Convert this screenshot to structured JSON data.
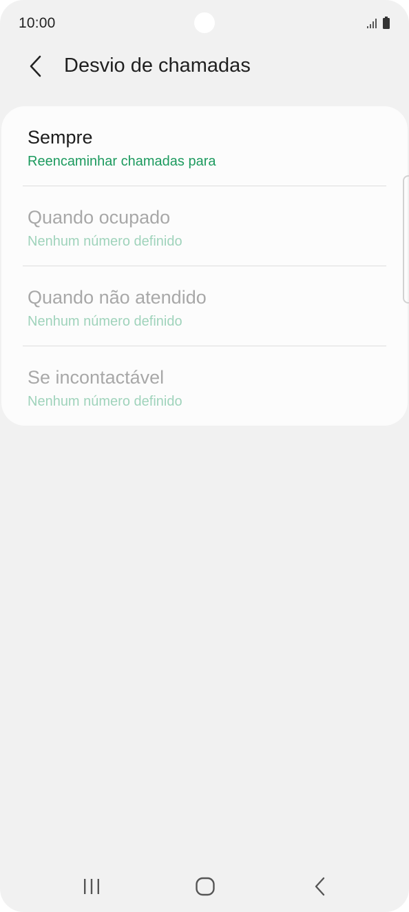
{
  "status_bar": {
    "time": "10:00",
    "icons": [
      "signal-icon",
      "battery-icon"
    ]
  },
  "header": {
    "title": "Desvio de chamadas",
    "back_icon": "chevron-left-icon"
  },
  "settings": [
    {
      "title": "Sempre",
      "subtitle": "Reencaminhar chamadas para",
      "enabled": true
    },
    {
      "title": "Quando ocupado",
      "subtitle": "Nenhum número definido",
      "enabled": false
    },
    {
      "title": "Quando não atendido",
      "subtitle": "Nenhum número definido",
      "enabled": false
    },
    {
      "title": "Se incontactável",
      "subtitle": "Nenhum número definido",
      "enabled": false
    }
  ],
  "nav_bar": {
    "icons": [
      "recents-icon",
      "home-icon",
      "back-icon"
    ]
  },
  "colors": {
    "background": "#f1f1f1",
    "card": "#fcfcfc",
    "accent": "#1c9a5e",
    "accent_disabled": "#9fd3bb",
    "text_primary": "#1c1c1c",
    "text_disabled": "#a8a8a8"
  }
}
